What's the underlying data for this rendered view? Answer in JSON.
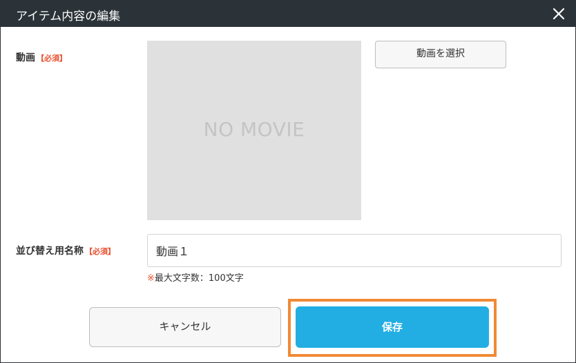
{
  "dialog": {
    "title": "アイテム内容の編集",
    "close_icon": "close-icon"
  },
  "video": {
    "label": "動画",
    "required": "【必須】",
    "placeholder_text": "NO MOVIE",
    "select_button": "動画を選択"
  },
  "sort_name": {
    "label": "並び替え用名称",
    "required": "【必須】",
    "value": "動画１",
    "note_mark": "※",
    "note": "最大文字数：100文字"
  },
  "actions": {
    "cancel": "キャンセル",
    "save": "保存"
  },
  "colors": {
    "titlebar": "#2b3339",
    "required": "#e8502f",
    "save": "#22aee3",
    "highlight": "#f08a35"
  }
}
